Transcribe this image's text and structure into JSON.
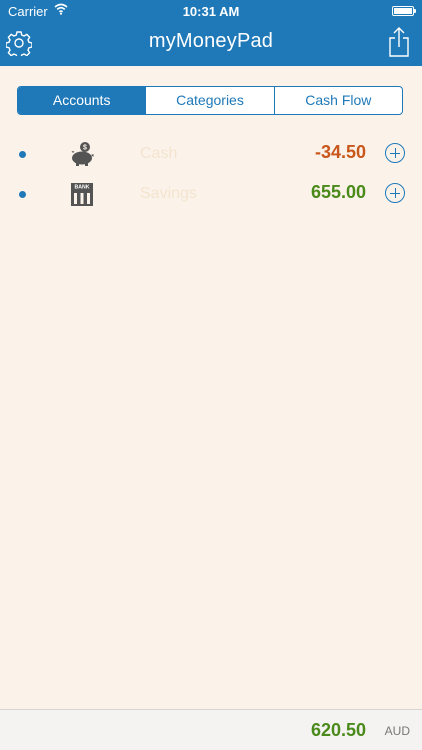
{
  "status_bar": {
    "carrier": "Carrier",
    "time": "10:31 AM"
  },
  "header": {
    "title": "myMoneyPad"
  },
  "tabs": [
    {
      "label": "Accounts",
      "active": true
    },
    {
      "label": "Categories",
      "active": false
    },
    {
      "label": "Cash Flow",
      "active": false
    }
  ],
  "accounts": [
    {
      "name": "Cash",
      "amount": "-34.50",
      "amount_color": "#c9561a",
      "icon": "piggy-bank-icon"
    },
    {
      "name": "Savings",
      "amount": "655.00",
      "amount_color": "#4a8a1a",
      "icon": "bank-icon"
    }
  ],
  "bank_icon_text": "BANK",
  "footer": {
    "total": "620.50",
    "currency": "AUD"
  },
  "colors": {
    "accent": "#1f79b8",
    "background": "#fbf3ea"
  }
}
